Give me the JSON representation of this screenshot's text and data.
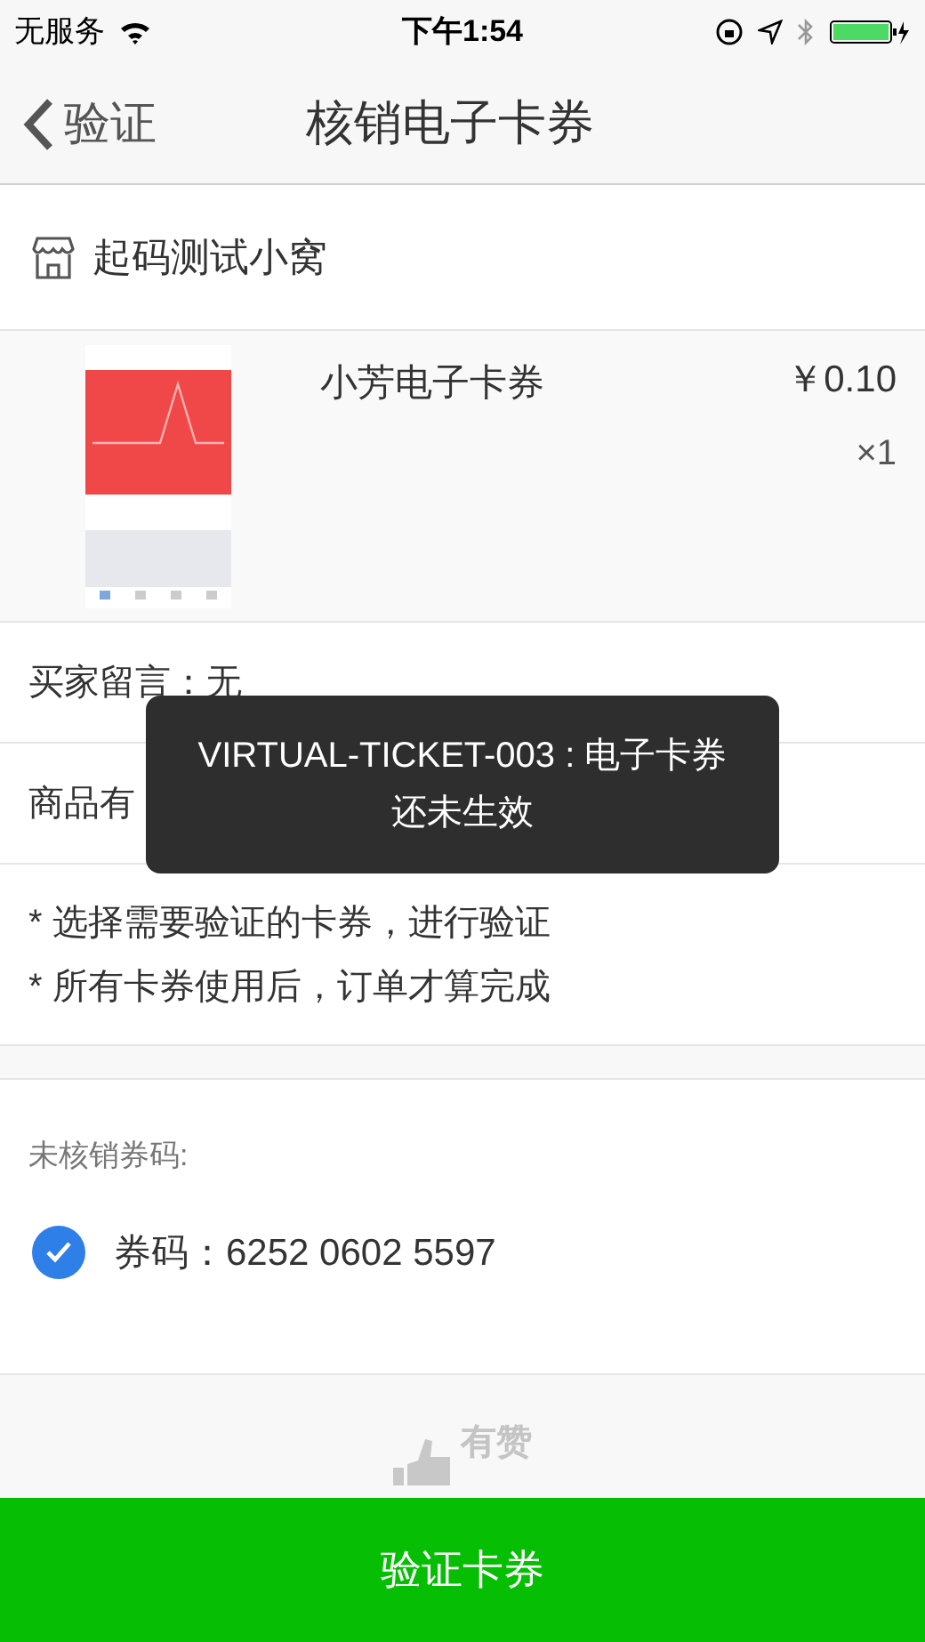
{
  "status_bar": {
    "carrier": "无服务",
    "time": "下午1:54"
  },
  "nav": {
    "back": "验证",
    "title": "核销电子卡券"
  },
  "shop": {
    "name": "起码测试小窝"
  },
  "product": {
    "name": "小芳电子卡券",
    "price": "￥0.10",
    "quantity": "×1"
  },
  "info_rows": [
    {
      "text": "买家留言：无"
    },
    {
      "text": "商品有"
    }
  ],
  "notes": [
    "* 选择需要验证的卡券，进行验证",
    "* 所有卡券使用后，订单才算完成"
  ],
  "codes_section": {
    "label": "未核销券码:",
    "codes": [
      {
        "text": "券码：6252 0602 5597",
        "selected": true
      }
    ]
  },
  "footer_brand": "有赞",
  "toast": "VIRTUAL-TICKET-003 : 电子卡券还未生效",
  "primary_button": "验证卡券"
}
